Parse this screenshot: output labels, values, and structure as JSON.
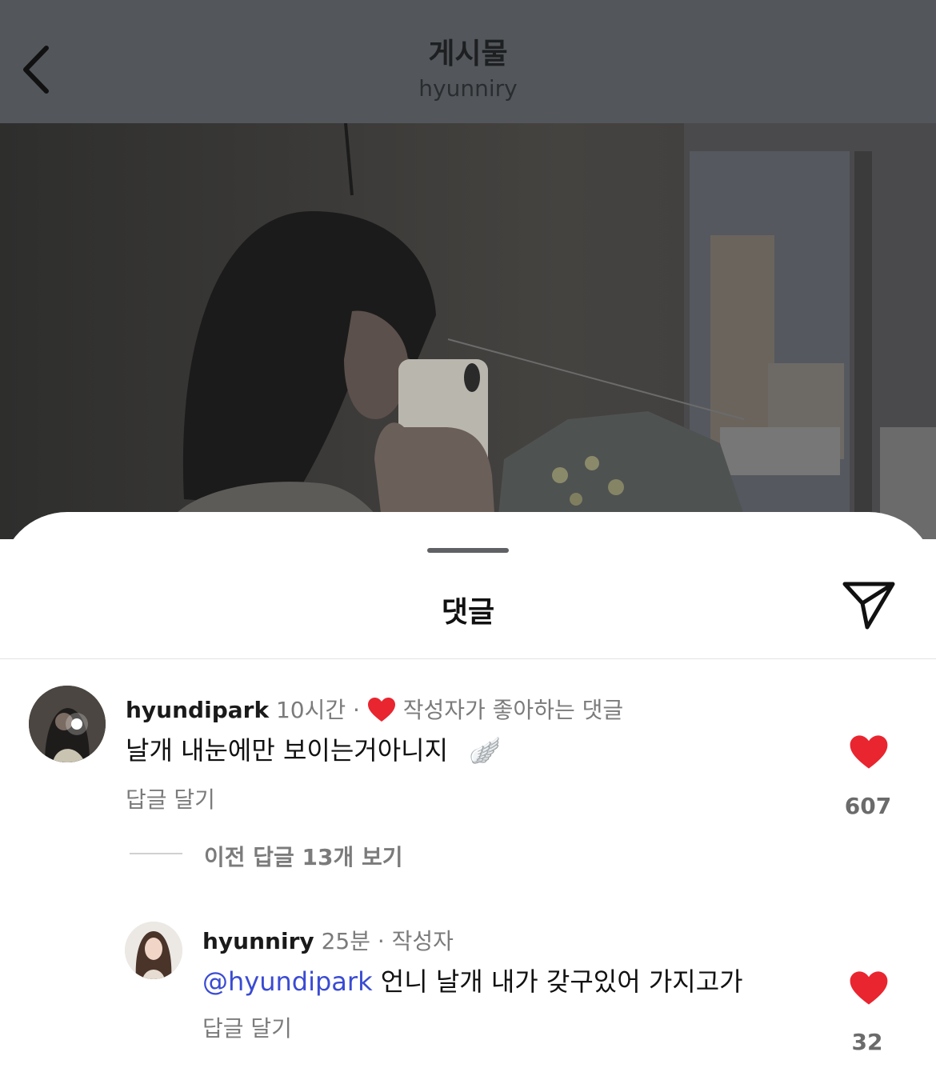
{
  "header": {
    "title": "게시물",
    "subtitle": "hyunniry"
  },
  "sheet": {
    "title": "댓글"
  },
  "comments": [
    {
      "username": "hyundipark",
      "time": "10시간 ·",
      "badge": "작성자가 좋아하는 댓글",
      "text": "날개 내눈에만 보이는거아니지",
      "emoji": "🪽",
      "reply_label": "답글 달기",
      "likes": "607",
      "view_replies": "이전 답글 13개 보기"
    },
    {
      "username": "hyunniry",
      "time": "25분 · 작성자",
      "mention": "@hyundipark",
      "text": " 언니 날개 내가 갖구있어 가지고가",
      "reply_label": "답글 달기",
      "likes": "32"
    }
  ],
  "colors": {
    "heart": "#e9252f",
    "mention": "#3a4bd3",
    "header_dim": "#53575b"
  },
  "icons": {
    "back": "chevron-left-icon",
    "share": "paper-plane-icon",
    "like": "heart-icon"
  }
}
